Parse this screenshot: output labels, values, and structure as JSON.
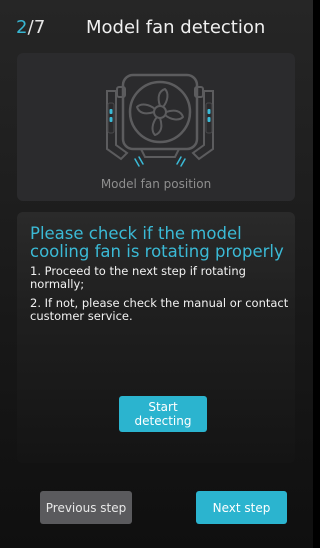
{
  "header": {
    "step_current": "2",
    "step_separator": "/",
    "step_total": "7",
    "title": "Model fan detection"
  },
  "fan_card": {
    "caption": "Model fan position",
    "icon": "fan-icon"
  },
  "instructions": {
    "headline": "Please check if the model cooling fan is rotating properly",
    "line1": "1. Proceed to the next step if rotating normally;",
    "line2": "2. If not, please check the manual or contact customer service."
  },
  "buttons": {
    "start": "Start detecting",
    "previous": "Previous step",
    "next": "Next step"
  },
  "colors": {
    "accent": "#2bb4cf",
    "background": "#1a1a1a",
    "card": "#2b2b2d",
    "secondary_button": "#5a5a5d"
  }
}
